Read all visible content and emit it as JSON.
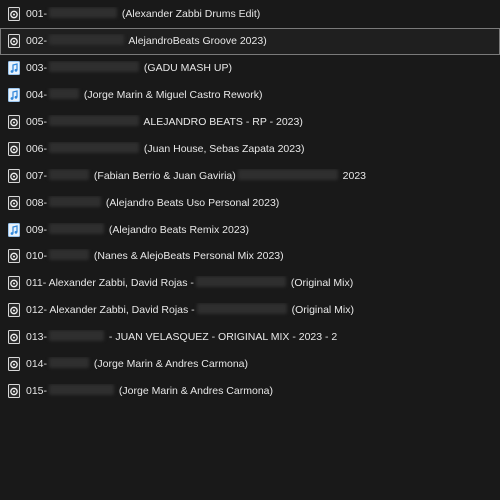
{
  "files": [
    {
      "name": "001-",
      "suffix": " (Alexander Zabbi Drums Edit)",
      "icon": "audio-file-icon",
      "selected": false
    },
    {
      "name": "002-",
      "suffix": " AlejandroBeats Groove 2023)",
      "icon": "audio-file-icon",
      "selected": true
    },
    {
      "name": "003-",
      "suffix": " (GADU MASH UP)",
      "icon": "music-file-icon",
      "selected": false
    },
    {
      "name": "004-",
      "suffix": " (Jorge Marin & Miguel Castro Rework)",
      "icon": "music-file-icon",
      "selected": false
    },
    {
      "name": "005-",
      "suffix": " ALEJANDRO BEATS - RP - 2023)",
      "icon": "audio-file-icon",
      "selected": false
    },
    {
      "name": "006-",
      "suffix": " (Juan House, Sebas Zapata 2023)",
      "icon": "audio-file-icon",
      "selected": false
    },
    {
      "name": "007-",
      "suffix": " (Fabian Berrio & Juan Gaviria)",
      "suffix2": " 2023",
      "icon": "audio-file-icon",
      "selected": false
    },
    {
      "name": "008-",
      "suffix": " (Alejandro Beats Uso Personal 2023)",
      "icon": "audio-file-icon",
      "selected": false
    },
    {
      "name": "009-",
      "suffix": " (Alejandro Beats Remix 2023)",
      "icon": "music-file-icon",
      "selected": false
    },
    {
      "name": "010-",
      "suffix": " (Nanes & AlejoBeats Personal Mix 2023)",
      "icon": "audio-file-icon",
      "selected": false
    },
    {
      "name": "011- Alexander Zabbi, David Rojas -",
      "suffix": " (Original Mix)",
      "icon": "audio-file-icon",
      "selected": false
    },
    {
      "name": "012- Alexander Zabbi, David Rojas -",
      "suffix": " (Original Mix)",
      "icon": "audio-file-icon",
      "selected": false
    },
    {
      "name": "013-",
      "suffix": " - JUAN VELASQUEZ - ORIGINAL MIX - 2023 - 2",
      "icon": "audio-file-icon",
      "selected": false
    },
    {
      "name": "014-",
      "suffix": " (Jorge Marin & Andres Carmona)",
      "icon": "audio-file-icon",
      "selected": false
    },
    {
      "name": "015-",
      "suffix": " (Jorge Marin & Andres Carmona)",
      "icon": "audio-file-icon",
      "selected": false
    }
  ],
  "colors": {
    "background": "#191919",
    "text": "#e8e8e8",
    "selection_border": "#7a7a7a",
    "audio_icon": "#e0e0e0",
    "music_icon": "#4a9eea"
  }
}
